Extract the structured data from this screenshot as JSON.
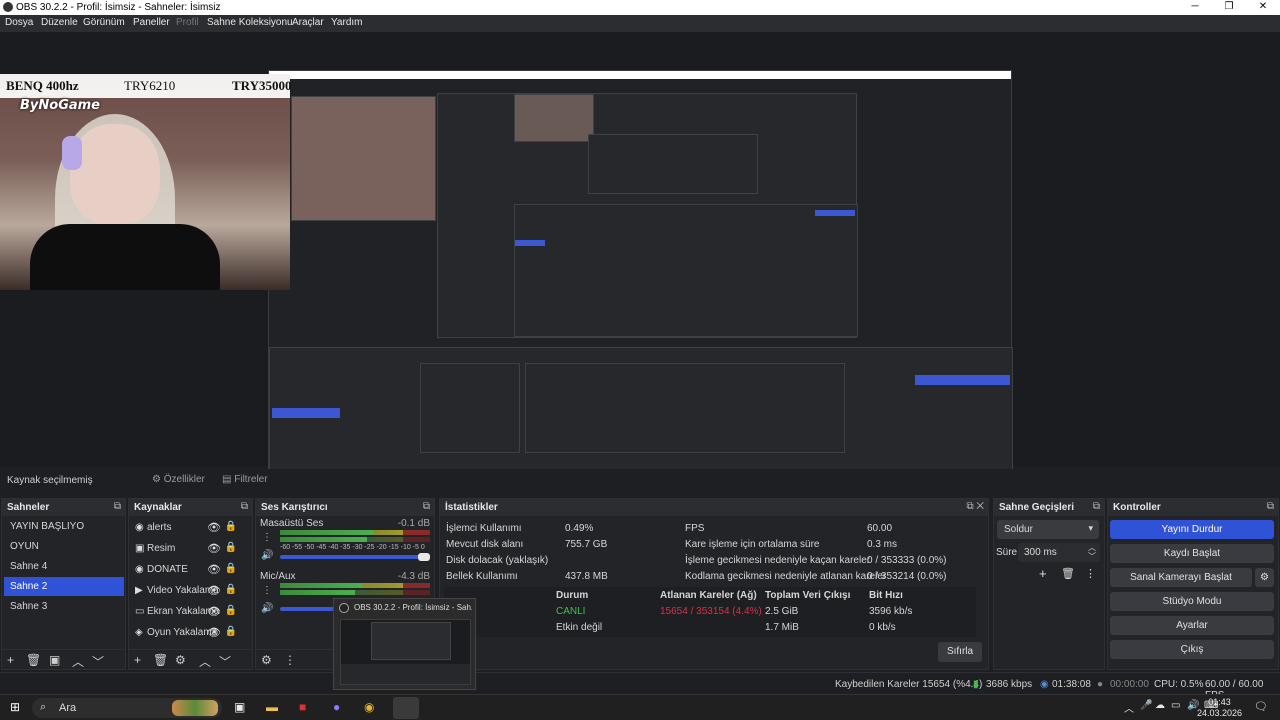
{
  "window": {
    "title": "OBS 30.2.2 - Profil: İsimsiz - Sahneler: İsimsiz"
  },
  "menu": [
    "Dosya",
    "Düzenle",
    "Görünüm",
    "Paneller",
    "Profil",
    "Sahne Koleksiyonu",
    "Araçlar",
    "Yardım"
  ],
  "preview": {
    "overlay": {
      "left": "BENQ 400hz",
      "mid": "TRY6210",
      "right": "TRY35000"
    },
    "brand": "ByNoGame"
  },
  "source_bar": {
    "label": "Kaynak seçilmemiş",
    "properties": "Özellikler",
    "filters": "Filtreler"
  },
  "scenes": {
    "title": "Sahneler",
    "items": [
      "YAYIN BAŞLIYO",
      "OYUN",
      "Sahne 4",
      "Sahne 2",
      "Sahne 3"
    ],
    "selected": "Sahne 2"
  },
  "sources": {
    "title": "Kaynaklar",
    "items": [
      "alerts",
      "Resim",
      "DONATE",
      "Video Yakalama",
      "Ekran Yakalama",
      "Oyun Yakalama"
    ]
  },
  "mixer": {
    "title": "Ses Karıştırıcı",
    "channels": [
      {
        "name": "Masaüstü Ses",
        "db": "-0.1 dB",
        "level": 0.62
      },
      {
        "name": "Mic/Aux",
        "db": "-4.3 dB",
        "level": 0.55
      }
    ],
    "ticks": "-60 -55 -50 -45 -40 -35 -30 -25 -20 -15 -10 -5  0"
  },
  "stats": {
    "title": "İstatistikler",
    "left": [
      {
        "label": "İşlemci Kullanımı",
        "value": "0.49%"
      },
      {
        "label": "Mevcut disk alanı",
        "value": "755.7 GB"
      },
      {
        "label": "Disk dolacak (yaklaşık)",
        "value": ""
      },
      {
        "label": "Bellek Kullanımı",
        "value": "437.8 MB"
      }
    ],
    "right": [
      {
        "label": "FPS",
        "value": "60.00"
      },
      {
        "label": "Kare işleme için ortalama süre",
        "value": "0.3 ms"
      },
      {
        "label": "İşleme gecikmesi nedeniyle kaçan kareler",
        "value": "0 / 353333 (0.0%)"
      },
      {
        "label": "Kodlama gecikmesi nedeniyle atlanan kareler",
        "value": "0 / 353214 (0.0%)"
      }
    ],
    "table": {
      "headers": [
        "Durum",
        "Atlanan Kareler (Ağ)",
        "Toplam Veri Çıkışı",
        "Bit Hızı"
      ],
      "rows": [
        [
          "CANLI",
          "15654 / 353154 (4.4%)",
          "2.5 GiB",
          "3596 kb/s"
        ],
        [
          "Etkin değil",
          "",
          "1.7 MiB",
          "0 kb/s"
        ]
      ]
    },
    "reset": "Sıfırla"
  },
  "transitions": {
    "title": "Sahne Geçişleri",
    "type": "Soldur",
    "duration_label": "Süre",
    "duration": "300 ms"
  },
  "controls": {
    "title": "Kontroller",
    "buttons": [
      "Yayını Durdur",
      "Kaydı Başlat",
      "Sanal Kamerayı Başlat",
      "Stüdyo Modu",
      "Ayarlar",
      "Çıkış"
    ]
  },
  "status": {
    "dropped": "Kaybedilen Kareler 15654 (%4.4)",
    "bitrate": "3686 kbps",
    "stream_time": "01:38:08",
    "rec_time": "00:00:00",
    "cpu": "CPU: 0.5%",
    "fps": "60.00 / 60.00 FPS"
  },
  "taskbar": {
    "search": "Ara",
    "time": "01:43",
    "date": "24.03.2026"
  },
  "thumbnail": {
    "title": "OBS 30.2.2 - Profil: İsimsiz - Sah..."
  },
  "colors": {
    "accent": "#2f52d6",
    "live": "#3fbf52",
    "dropped": "#d9304a"
  }
}
